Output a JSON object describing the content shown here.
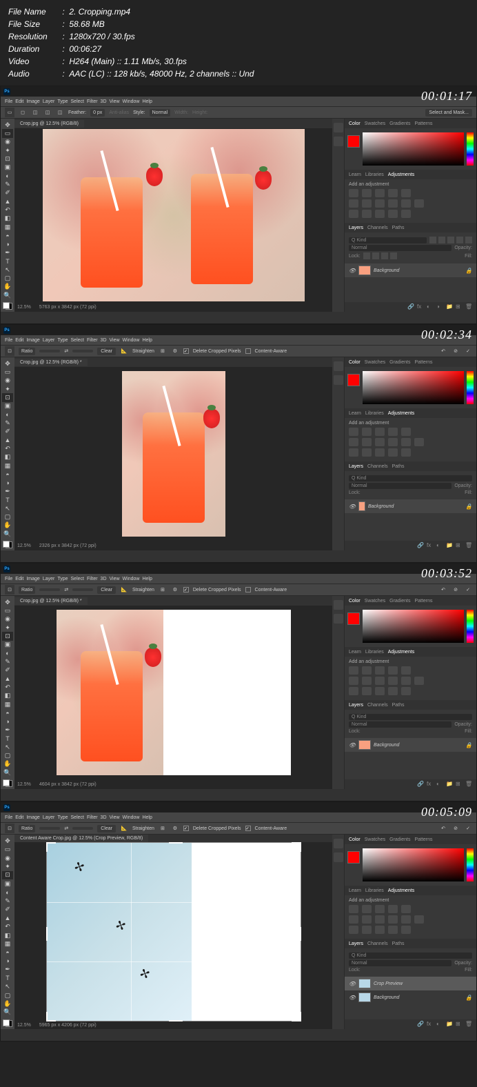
{
  "header": {
    "file_name_label": "File Name",
    "file_name": "2. Cropping.mp4",
    "file_size_label": "File Size",
    "file_size": "58.68 MB",
    "resolution_label": "Resolution",
    "resolution": "1280x720 / 30.fps",
    "duration_label": "Duration",
    "duration": "00:06:27",
    "video_label": "Video",
    "video": "H264 (Main) :: 1.11 Mb/s, 30.fps",
    "audio_label": "Audio",
    "audio": "AAC (LC) :: 128 kb/s, 48000 Hz, 2 channels :: Und"
  },
  "menu": [
    "File",
    "Edit",
    "Image",
    "Layer",
    "Type",
    "Select",
    "Filter",
    "3D",
    "View",
    "Window",
    "Help"
  ],
  "panel_tabs": {
    "color": "Color",
    "swatches": "Swatches",
    "gradients": "Gradients",
    "patterns": "Patterns"
  },
  "adjust_tabs": {
    "learn": "Learn",
    "libraries": "Libraries",
    "adjustments": "Adjustments"
  },
  "adjust_title": "Add an adjustment",
  "layer_tabs": {
    "layers": "Layers",
    "channels": "Channels",
    "paths": "Paths"
  },
  "layer_controls": {
    "kind": "Q Kind",
    "blend": "Normal",
    "opacity": "Opacity:",
    "fill": "Fill:",
    "lock": "Lock:"
  },
  "frames": [
    {
      "timestamp": "00:01:17",
      "tab": "Crop.jpg @ 12.5% (RGB/8)",
      "options": {
        "mode": "marquee",
        "feather_label": "Feather:",
        "feather": "0 px",
        "style_label": "Style:",
        "style": "Normal",
        "select_mask": "Select and Mask..."
      },
      "layer_name": "Background",
      "status_zoom": "12.5%",
      "status_dim": "5763 px x 3842 px (72 ppi)"
    },
    {
      "timestamp": "00:02:34",
      "tab": "Crop.jpg @ 12.5% (RGB/8) *",
      "options": {
        "ratio": "Ratio",
        "clear": "Clear",
        "straighten": "Straighten",
        "delete_label": "Delete Cropped Pixels",
        "content_aware": "Content-Aware"
      },
      "layer_name": "Background",
      "status_zoom": "12.5%",
      "status_dim": "2326 px x 3842 px (72 ppi)"
    },
    {
      "timestamp": "00:03:52",
      "tab": "Crop.jpg @ 12.5% (RGB/8) *",
      "options": {
        "ratio": "Ratio",
        "clear": "Clear",
        "straighten": "Straighten",
        "delete_label": "Delete Cropped Pixels",
        "content_aware": "Content-Aware"
      },
      "layer_name": "Background",
      "status_zoom": "12.5%",
      "status_dim": "4604 px x 3842 px (72 ppi)"
    },
    {
      "timestamp": "00:05:09",
      "tab": "Content Aware Crop.jpg @ 12.5% (Crop Preview, RGB/8)",
      "options": {
        "ratio": "Ratio",
        "clear": "Clear",
        "straighten": "Straighten",
        "delete_label": "Delete Cropped Pixels",
        "content_aware": "Content-Aware",
        "checked": true
      },
      "layer_name_1": "Crop Preview",
      "layer_name_2": "Background",
      "status_zoom": "12.5%",
      "status_dim": "5965 px x 4206 px (72 ppi)"
    }
  ]
}
